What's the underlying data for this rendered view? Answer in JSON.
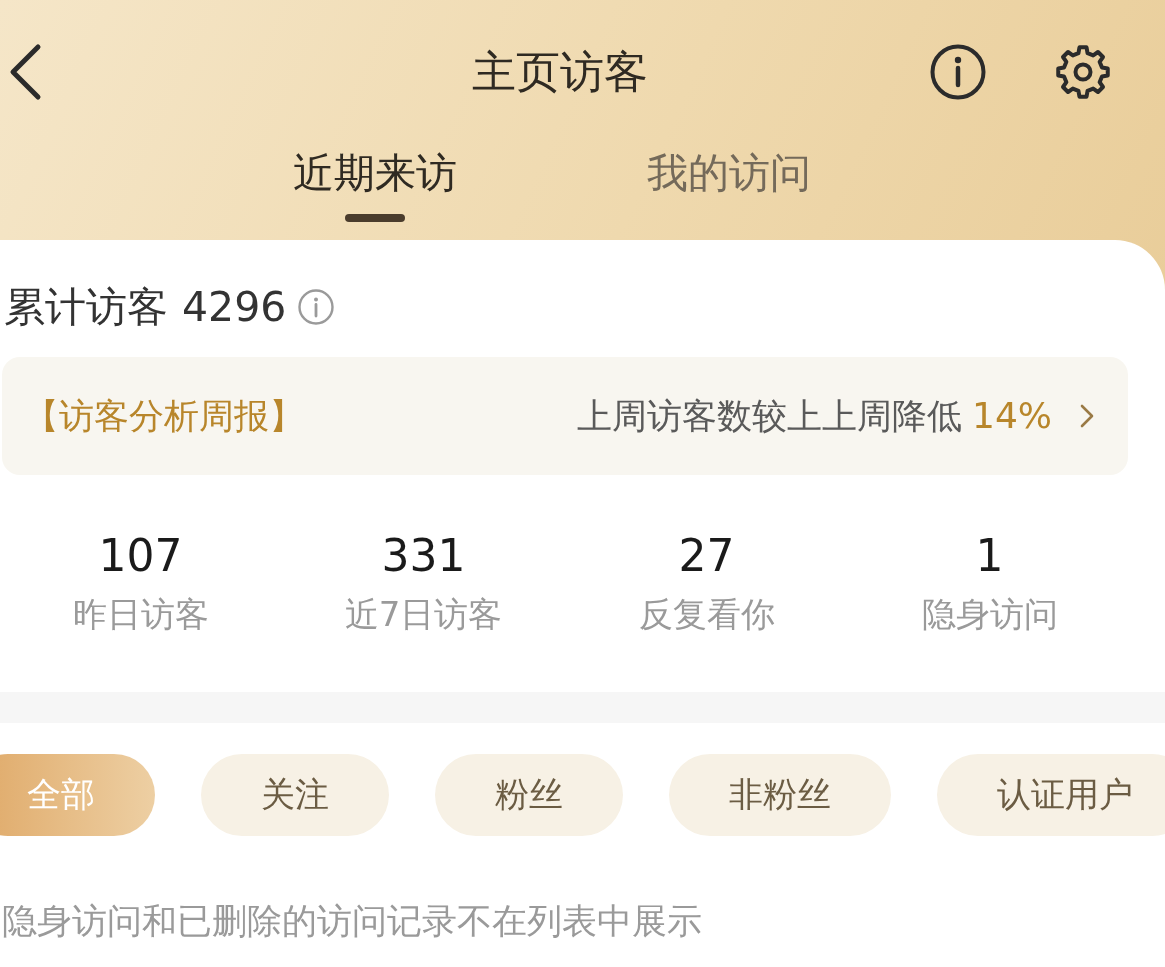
{
  "header": {
    "title": "主页访客"
  },
  "tabs": [
    {
      "label": "近期来访",
      "selected": true
    },
    {
      "label": "我的访问",
      "selected": false
    }
  ],
  "total": {
    "label": "累计访客",
    "value": "4296"
  },
  "weekly_report": {
    "title": "【访客分析周报】",
    "summary": "上周访客数较上上周降低",
    "change": "14%"
  },
  "stats": [
    {
      "value": "107",
      "label": "昨日访客"
    },
    {
      "value": "331",
      "label": "近7日访客"
    },
    {
      "value": "27",
      "label": "反复看你"
    },
    {
      "value": "1",
      "label": "隐身访问"
    }
  ],
  "filters": [
    {
      "label": "全部",
      "selected": true
    },
    {
      "label": "关注",
      "selected": false
    },
    {
      "label": "粉丝",
      "selected": false
    },
    {
      "label": "非粉丝",
      "selected": false
    },
    {
      "label": "认证用户",
      "selected": false
    }
  ],
  "note": "隐身访问和已删除的访问记录不在列表中展示"
}
